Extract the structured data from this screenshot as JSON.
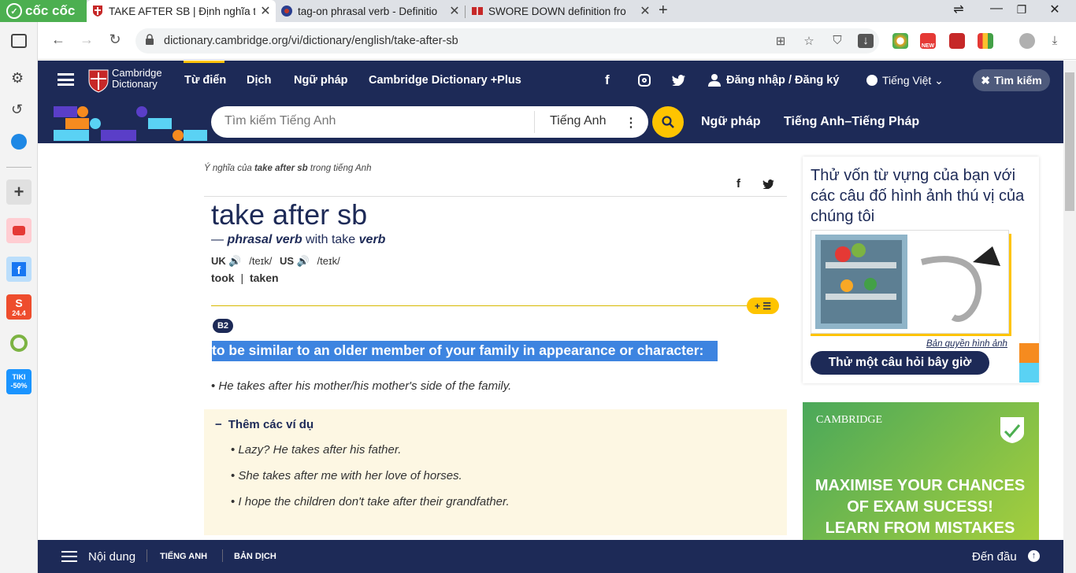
{
  "browser": {
    "brand": "cốc cốc",
    "tabs": [
      {
        "title": "TAKE AFTER SB | Định nghĩa t",
        "active": true
      },
      {
        "title": "tag-on phrasal verb - Definitio",
        "active": false
      },
      {
        "title": "SWORE DOWN definition fro",
        "active": false
      }
    ],
    "url": "dictionary.cambridge.org/vi/dictionary/english/take-after-sb"
  },
  "header": {
    "logo_line1": "Cambridge",
    "logo_line2": "Dictionary",
    "nav": [
      "Từ điển",
      "Dịch",
      "Ngữ pháp",
      "Cambridge Dictionary +Plus"
    ],
    "login": "Đăng nhập / Đăng ký",
    "language": "Tiếng Việt",
    "search_close": "Tìm kiếm",
    "search_placeholder": "Tìm kiếm Tiếng Anh",
    "search_lang": "Tiếng Anh",
    "nav2": [
      "Ngữ pháp",
      "Tiếng Anh–Tiếng Pháp"
    ]
  },
  "entry": {
    "breadcrumb_pre": "Ý nghĩa của ",
    "breadcrumb_word": "take after sb",
    "breadcrumb_post": " trong tiếng Anh",
    "headword": "take after sb",
    "pos_dash": "— ",
    "pos": "phrasal verb",
    "with": " with take ",
    "pos2": "verb",
    "uk": "UK",
    "uk_ipa": "/teɪk/",
    "us": "US",
    "us_ipa": "/teɪk/",
    "form1": "took",
    "form_sep": "|",
    "form2": "taken",
    "level": "B2",
    "definition": "to be similar to an older member of your family in appearance or character:",
    "example": "He takes after his mother/his mother's side of the family.",
    "more_title": "Thêm các ví dụ",
    "more_examples": [
      "Lazy? He takes after his father.",
      "She takes after me with her love of horses.",
      "I hope the children don't take after their grandfather."
    ]
  },
  "sidebar": {
    "quiz_title": "Thử vốn từ vựng của bạn với các câu đố hình ảnh thú vị của chúng tôi",
    "copyright": "Bản quyền hình ảnh",
    "quiz_button": "Thử một câu hỏi bây giờ",
    "ad_brand": "CAMBRIDGE",
    "ad_line1": "MAXIMISE YOUR CHANCES",
    "ad_line2": "OF EXAM SUCESS!",
    "ad_line3": "LEARN FROM MISTAKES"
  },
  "bottom": {
    "menu": "Nội dung",
    "tab1": "TIẾNG ANH",
    "tab2": "BẢN DỊCH",
    "top": "Đến đầu"
  },
  "left_apps": {
    "tiki_label": "TIKI",
    "tiki_discount": "-50%",
    "shopee_label": "24.4"
  },
  "colors": {
    "navy": "#1d2a57",
    "gold": "#fec400",
    "highlight": "#3d84e0",
    "coccoc_green": "#4caf50"
  }
}
